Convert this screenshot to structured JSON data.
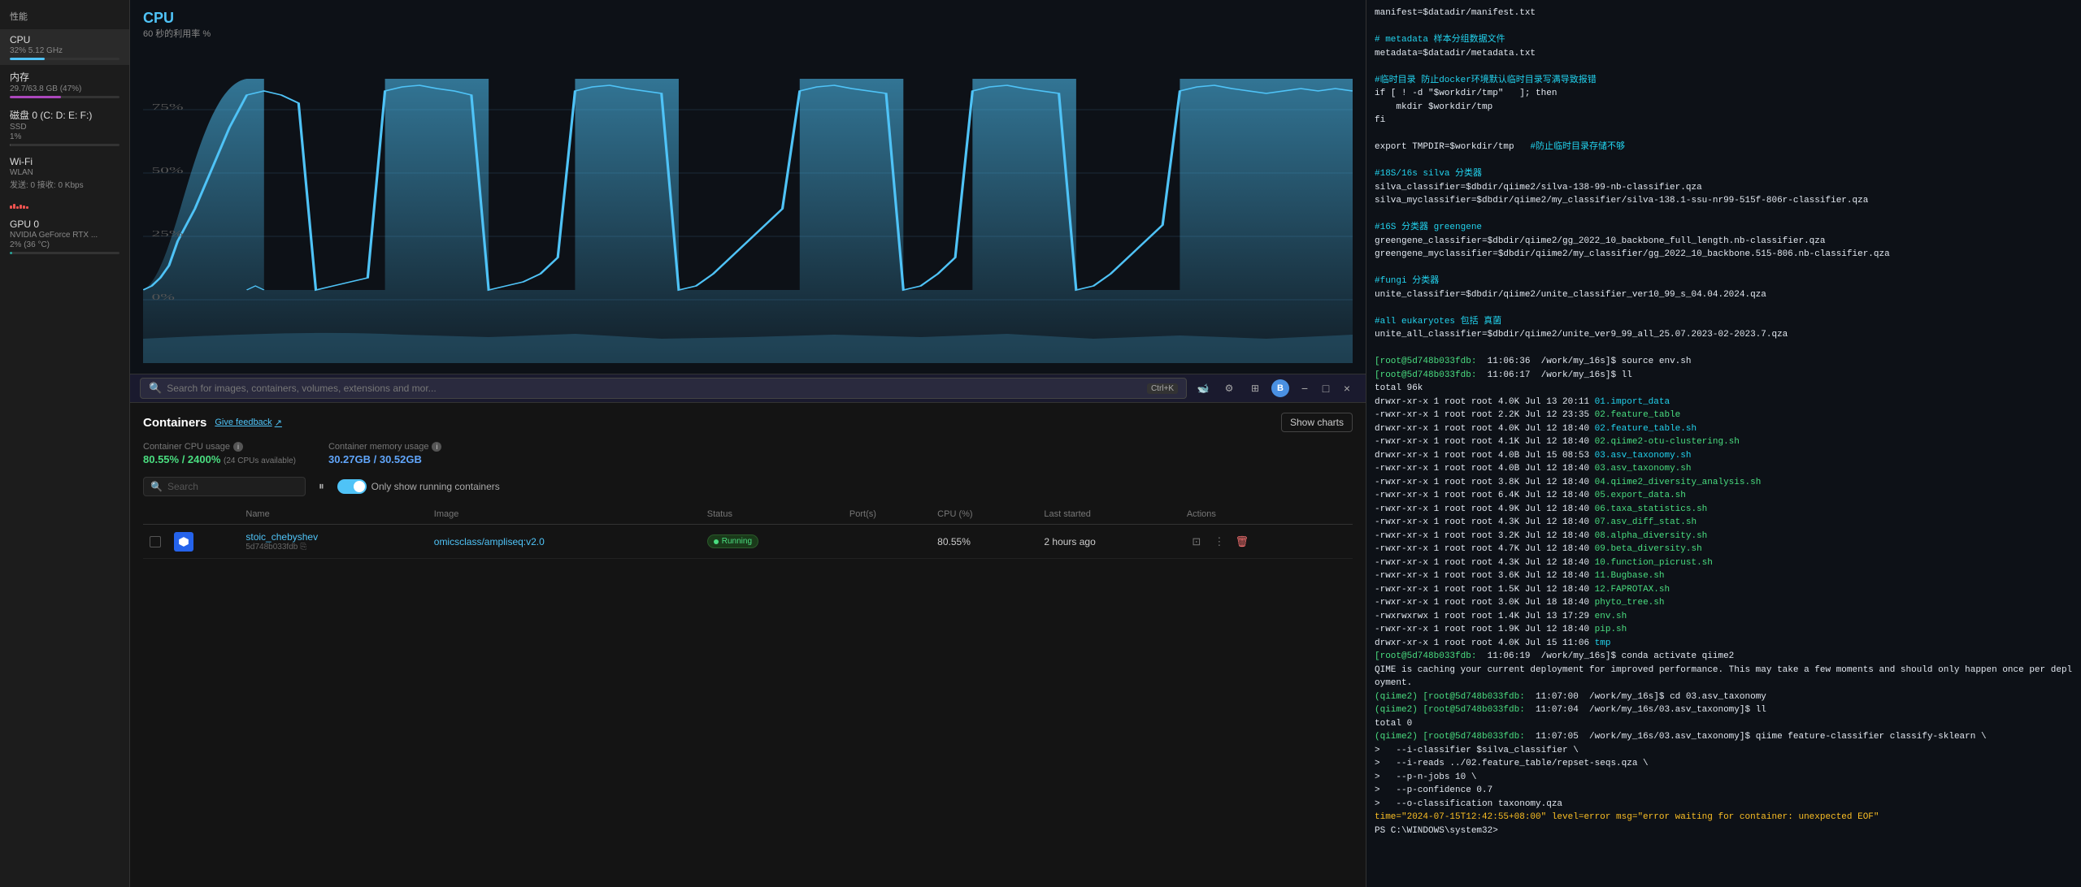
{
  "sidebar": {
    "title": "性能",
    "items": [
      {
        "name": "CPU",
        "sub": "32%  5.12 GHz",
        "progress": 32,
        "color": "cpu-color"
      },
      {
        "name": "内存",
        "sub": "29.7/63.8 GB (47%)",
        "progress": 47,
        "color": "mem-color"
      },
      {
        "name": "磁盘 0 (C: D: E: F:)",
        "sub2": "SSD",
        "sub3": "1%",
        "progress": 1,
        "color": "disk-color"
      },
      {
        "name": "Wi-Fi",
        "sub": "WLAN",
        "sub2": "发送: 0  接收: 0 Kbps",
        "color": "wifi-color"
      },
      {
        "name": "GPU 0",
        "sub": "NVIDIA GeForce RTX ...",
        "sub2": "2% (36 °C)",
        "progress": 2,
        "color": "gpu-color"
      }
    ]
  },
  "cpu_chart": {
    "title": "CPU",
    "subtitle": "60 秒的利用率 %"
  },
  "taskbar": {
    "search_placeholder": "Search for images, containers, volumes, extensions and mor...",
    "shortcut": "Ctrl+K",
    "avatar": "B",
    "minimize": "−",
    "maximize": "□",
    "close": "×"
  },
  "containers": {
    "title": "Containers",
    "give_feedback": "Give feedback",
    "show_charts": "Show charts",
    "cpu_usage_label": "Container CPU usage",
    "cpu_usage_value": "80.55% / 2400%",
    "cpu_usage_sub": "(24 CPUs available)",
    "mem_usage_label": "Container memory usage",
    "mem_usage_value": "30.27GB / 30.52GB",
    "search_placeholder": "Search",
    "only_running": "Only show running containers",
    "columns": [
      "",
      "",
      "Name",
      "Image",
      "Status",
      "Port(s)",
      "CPU (%)",
      "Last started",
      "Actions"
    ],
    "rows": [
      {
        "name": "stoic_chebyshev",
        "id": "5d748b033fdb",
        "image": "omicsclass/ampliseq:v2.0",
        "status": "Running",
        "ports": "",
        "cpu": "80.55%",
        "last_started": "2 hours ago"
      }
    ]
  },
  "terminal": {
    "lines": [
      "manifest=$datadir/manifest.txt",
      "",
      "# metadata 样本分组数据文件",
      "metadata=$datadir/metadata.txt",
      "",
      "#临时目录 防止docker环境默认临时目录写满导致报错",
      "if [ ! -d \"$workdir/tmp\"   ]; then",
      "    mkdir $workdir/tmp",
      "fi",
      "",
      "export TMPDIR=$workdir/tmp   #防止临时目录存储不够",
      "",
      "#18S/16s silva 分类器",
      "silva_classifier=$dbdir/qiime2/silva-138-99-nb-classifier.qza",
      "silva_myclassifier=$dbdir/qiime2/my_classifier/silva-138.1-ssu-nr99-515f-806r-classifier.qza",
      "",
      "#16S 分类器 greengene",
      "greengene_classifier=$dbdir/qiime2/gg_2022_10_backbone_full_length.nb-classifier.qza",
      "greengene_myclassifier=$dbdir/qiime2/my_classifier/gg_2022_10_backbone.515-806.nb-classifier.qza",
      "",
      "#fungi 分类器",
      "unite_classifier=$dbdir/qiime2/unite_classifier_ver10_99_s_04.04.2024.qza",
      "",
      "#all eukaryotes 包括 真菌",
      "unite_all_classifier=$dbdir/qiime2/unite_ver9_99_all_25.07.2023-02-2023.7.qza",
      "",
      "[root@5d748b033fdb:  11:06:36  /work/my_16s]$ source env.sh",
      "[root@5d748b033fdb:  11:06:17  /work/my_16s]$ ll",
      "total 96k",
      "drwxr-xr-x 1 root root 4.0K Jul 13 20:11 01.import_data",
      "-rwxr-xr-x 1 root root 2.2K Jul 12 23:35 02.feature_table",
      "drwxr-xr-x 1 root root 4.0K Jul 12 18:40 02.feature_table.sh",
      "-rwxr-xr-x 1 root root 4.1K Jul 12 18:40 02.qiime2-otu-clustering.sh",
      "drwxr-xr-x 1 root root 4.0B Jul 15 08:53 03.asv_taxonomy.sh",
      "-rwxr-xr-x 1 root root 4.0B Jul 12 18:40 03.asv_taxonomy.sh",
      "-rwxr-xr-x 1 root root 3.8K Jul 12 18:40 04.qiime2_diversity_analysis.sh",
      "-rwxr-xr-x 1 root root 6.4K Jul 12 18:40 05.export_data.sh",
      "-rwxr-xr-x 1 root root 4.9K Jul 12 18:40 06.taxa_statistics.sh",
      "-rwxr-xr-x 1 root root 4.3K Jul 12 18:40 07.asv_diff_stat.sh",
      "-rwxr-xr-x 1 root root 3.2K Jul 12 18:40 08.alpha_diversity.sh",
      "-rwxr-xr-x 1 root root 4.7K Jul 12 18:40 09.beta_diversity.sh",
      "-rwxr-xr-x 1 root root 4.3K Jul 12 18:40 10.function_picrust.sh",
      "-rwxr-xr-x 1 root root 3.6K Jul 12 18:40 11.Bugbase.sh",
      "-rwxr-xr-x 1 root root 1.5K Jul 12 18:40 12.FAPROTAX.sh",
      "-rwxr-xr-x 1 root root 3.0K Jul 18 18:40 phyto_tree.sh",
      "-rwxrwxrwx 1 root root 1.4K Jul 13 17:29 env.sh",
      "-rwxr-xr-x 1 root root 1.9K Jul 12 18:40 pip.sh",
      "drwxr-xr-x 1 root root 4.0K Jul 15 11:06 tmp",
      "[root@5d748b033fdb:  11:06:19  /work/my_16s]$ conda activate qiime2",
      "QIME is caching your current deployment for improved performance. This may take a few moments and should only happen once per deployment.",
      "(qiime2) [root@5d748b033fdb:  11:07:00  /work/my_16s]$ cd 03.asv_taxonomy",
      "(qiime2) [root@5d748b033fdb:  11:07:04  /work/my_16s/03.asv_taxonomy]$ ll",
      "total 0",
      "(qiime2) [root@5d748b033fdb:  11:07:05  /work/my_16s/03.asv_taxonomy]$ qiime feature-classifier classify-sklearn \\",
      ">   --i-classifier $silva_classifier \\",
      ">   --i-reads ../02.feature_table/repset-seqs.qza \\",
      ">   --p-n-jobs 10 \\",
      ">   --p-confidence 0.7",
      ">   --o-classification taxonomy.qza",
      "time=\"2024-07-15T12:42:55+08:00\" level=error msg=\"error waiting for container: unexpected EOF\"",
      "PS C:\\WINDOWS\\system32>"
    ]
  }
}
